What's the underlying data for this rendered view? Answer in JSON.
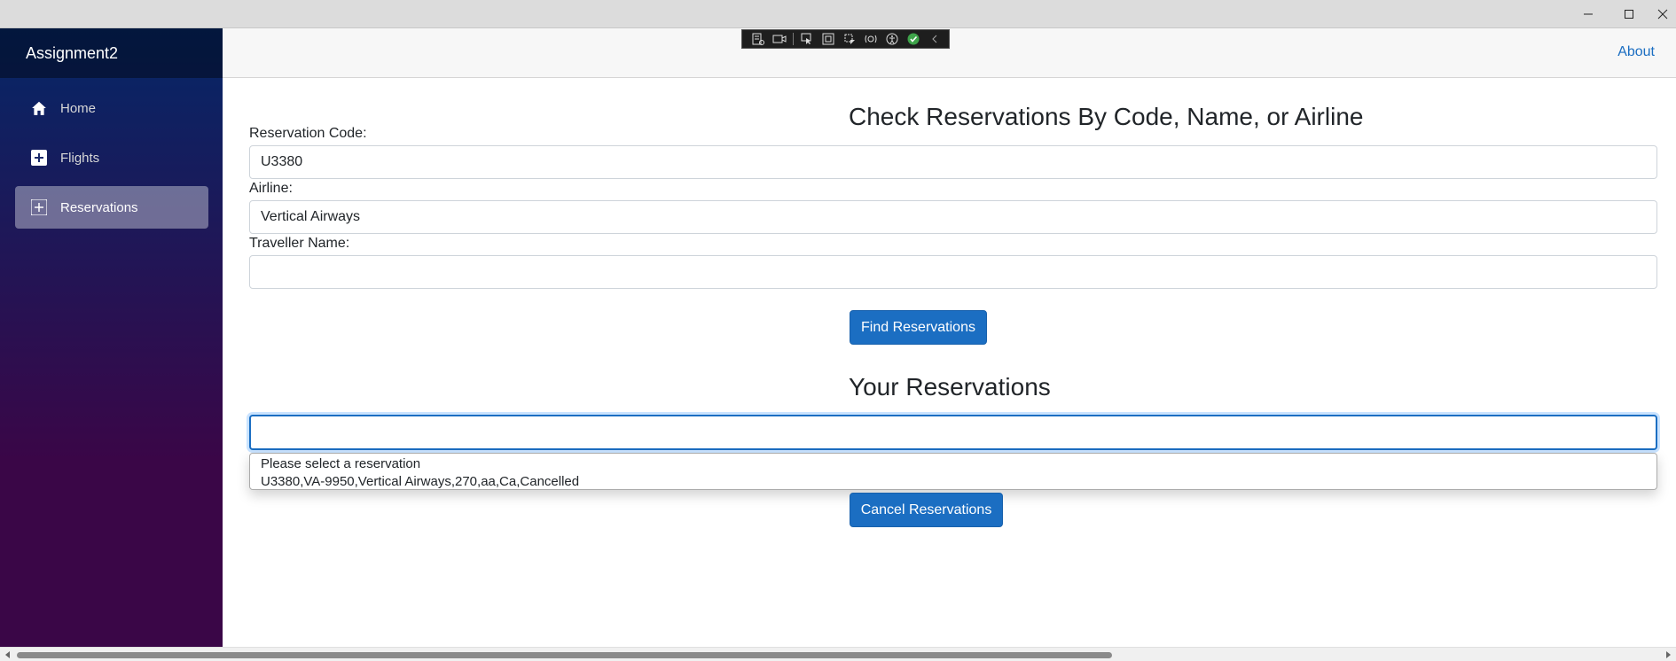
{
  "app": {
    "brand": "Assignment2",
    "about_link": "About"
  },
  "sidebar": {
    "items": [
      {
        "label": "Home",
        "icon": "home-icon"
      },
      {
        "label": "Flights",
        "icon": "plus-square-icon"
      },
      {
        "label": "Reservations",
        "icon": "plus-square-icon",
        "active": true
      }
    ]
  },
  "search": {
    "title": "Check Reservations By Code, Name, or Airline",
    "code_label": "Reservation Code:",
    "code_value": "U3380",
    "airline_label": "Airline:",
    "airline_value": "Vertical Airways",
    "name_label": "Traveller Name:",
    "name_value": "",
    "find_button": "Find Reservations"
  },
  "reservations": {
    "title": "Your Reservations",
    "selected_value": "",
    "options": [
      "Please select a reservation",
      "U3380,VA-9950,Vertical Airways,270,aa,Ca,Cancelled"
    ],
    "cancel_button": "Cancel Reservations"
  },
  "colors": {
    "accent": "#1b6ec2",
    "sidebar_top": "#052767",
    "sidebar_bottom": "#3a0647"
  }
}
